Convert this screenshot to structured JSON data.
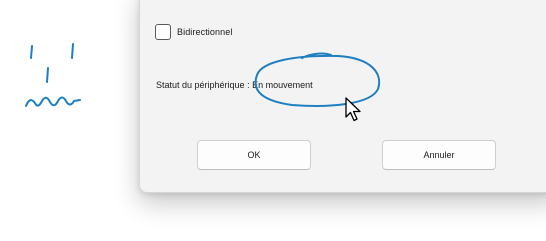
{
  "dialog": {
    "bidirectional_label": "Bidirectionnel",
    "bidirectional_checked": false,
    "status_label": "Statut du périphérique :",
    "status_value": "En mouvement",
    "ok_label": "OK",
    "cancel_label": "Annuler"
  },
  "colors": {
    "ink": "#1f7fc0",
    "dialog_bg": "#f3f3f3"
  }
}
